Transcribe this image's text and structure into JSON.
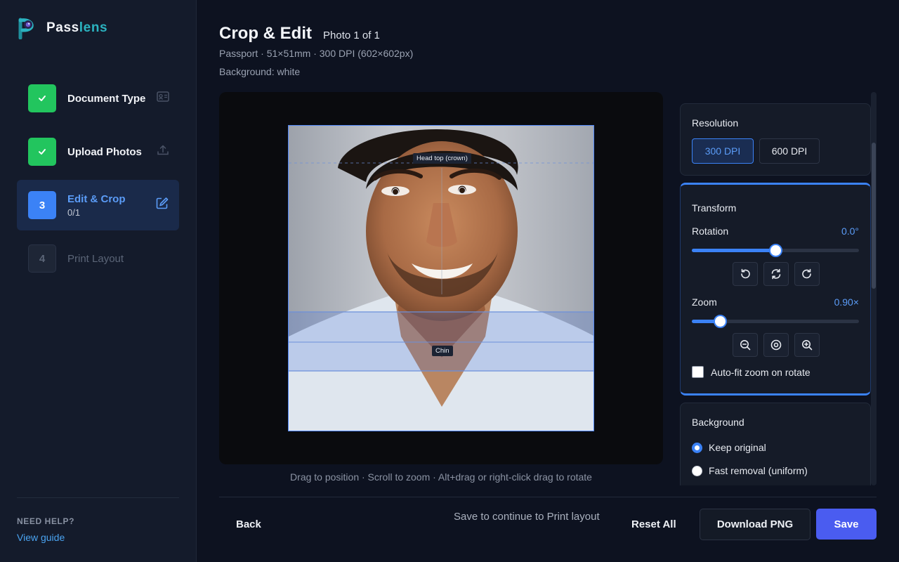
{
  "brand": {
    "name_part1": "Pass",
    "name_part2": "lens"
  },
  "steps": [
    {
      "badge": "",
      "label": "Document Type",
      "sub": "",
      "state": "done",
      "icon": "id-card-icon"
    },
    {
      "badge": "",
      "label": "Upload Photos",
      "sub": "",
      "state": "done",
      "icon": "upload-icon"
    },
    {
      "badge": "3",
      "label": "Edit & Crop",
      "sub": "0/1",
      "state": "current",
      "icon": "edit-icon"
    },
    {
      "badge": "4",
      "label": "Print Layout",
      "sub": "",
      "state": "pending",
      "icon": ""
    }
  ],
  "help": {
    "title": "NEED HELP?",
    "link": "View guide"
  },
  "header": {
    "title": "Crop & Edit",
    "photo_count": "Photo 1 of 1",
    "spec": "Passport · 51×51mm · 300 DPI (602×602px)",
    "background": "Background: white"
  },
  "editor": {
    "head_top_label": "Head top (crown)",
    "chin_label": "Chin",
    "hint": "Drag to position · Scroll to zoom · Alt+drag or right-click drag to rotate"
  },
  "resolution": {
    "title": "Resolution",
    "options": [
      "300 DPI",
      "600 DPI"
    ],
    "selected": "300 DPI"
  },
  "transform": {
    "title": "Transform",
    "rotation_label": "Rotation",
    "rotation_value": "0.0°",
    "rotation_level": 0.5,
    "zoom_label": "Zoom",
    "zoom_value": "0.90×",
    "zoom_level": 0.17,
    "autofit_label": "Auto-fit zoom on rotate",
    "autofit_checked": false
  },
  "background_panel": {
    "title": "Background",
    "options": [
      "Keep original",
      "Fast removal (uniform)"
    ],
    "selected": "Keep original"
  },
  "footer": {
    "back": "Back",
    "note": "Save to continue to Print layout",
    "reset": "Reset All",
    "download": "Download PNG",
    "save": "Save"
  },
  "colors": {
    "accent": "#3b82f6",
    "success": "#22c55e",
    "save": "#4a5cf0",
    "brand_teal": "#2bb3c0"
  }
}
